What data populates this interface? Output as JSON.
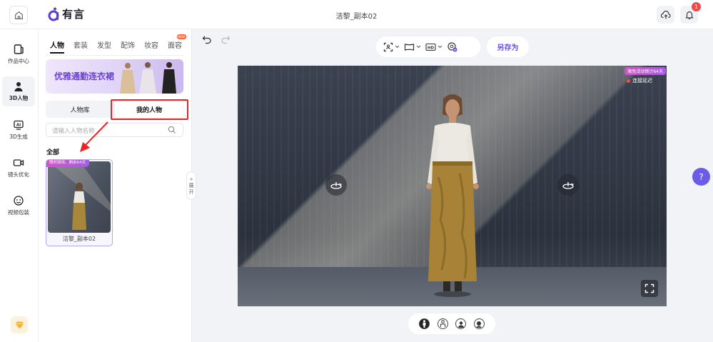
{
  "app": {
    "name": "有言",
    "document_title": "洁黎_副本02"
  },
  "topbar": {
    "notifications_count": "1"
  },
  "leftnav": {
    "items": [
      {
        "label": "作品中心",
        "icon": "works-icon",
        "active": false
      },
      {
        "label": "3D人物",
        "icon": "person-3d-icon",
        "active": true
      },
      {
        "label": "3D生成",
        "icon": "ai-generate-icon",
        "active": false
      },
      {
        "label": "镜头优化",
        "icon": "camera-icon",
        "active": false
      },
      {
        "label": "视频包装",
        "icon": "video-package-icon",
        "active": false
      }
    ]
  },
  "panel": {
    "tabs": [
      {
        "label": "人物",
        "active": true
      },
      {
        "label": "套装",
        "active": false
      },
      {
        "label": "发型",
        "active": false
      },
      {
        "label": "配饰",
        "active": false
      },
      {
        "label": "妆容",
        "active": false
      },
      {
        "label": "面容",
        "active": false,
        "badge": "NEW"
      }
    ],
    "banner_text": "优雅通勤连衣裙",
    "segments": [
      {
        "label": "人物库",
        "active": false
      },
      {
        "label": "我的人物",
        "active": true
      }
    ],
    "search_placeholder": "请输入人物名称",
    "section_title": "全部",
    "cards": [
      {
        "badge": "限时授用，剩余64天",
        "label": "洁黎_副本02"
      }
    ],
    "collapse_label_1": "展",
    "collapse_label_2": "开"
  },
  "toolbar": {
    "save_as_label": "另存为"
  },
  "stage": {
    "promo_text": "限免活动倒计64天",
    "latency_text": "连接延迟"
  },
  "help_label": "?",
  "colors": {
    "accent": "#6b4ce6",
    "annotation_red": "#e22222",
    "promo_gradient_start": "#d155c5",
    "promo_gradient_end": "#a45de3"
  }
}
